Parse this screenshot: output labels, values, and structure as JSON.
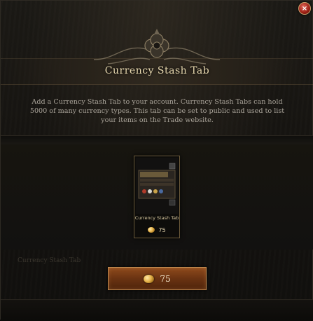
{
  "dialog": {
    "title": "Currency Stash Tab",
    "close_label": "×",
    "description": "Add a Currency Stash Tab to your account. Currency Stash Tabs can hold 5000 of many currency types. This tab can be set to public and used to list your items on the Trade website."
  },
  "item": {
    "name": "Currency Stash Tab",
    "price": "75",
    "price_icon": "gold-coin-icon"
  },
  "faded_label": "Currency Stash Tab",
  "buy_button": {
    "price": "75",
    "icon": "gold-coin-icon"
  },
  "colors": {
    "title_gold": "#e8d9b0",
    "button_orange": "#6a3312",
    "frame_border": "#6b5a3a"
  }
}
